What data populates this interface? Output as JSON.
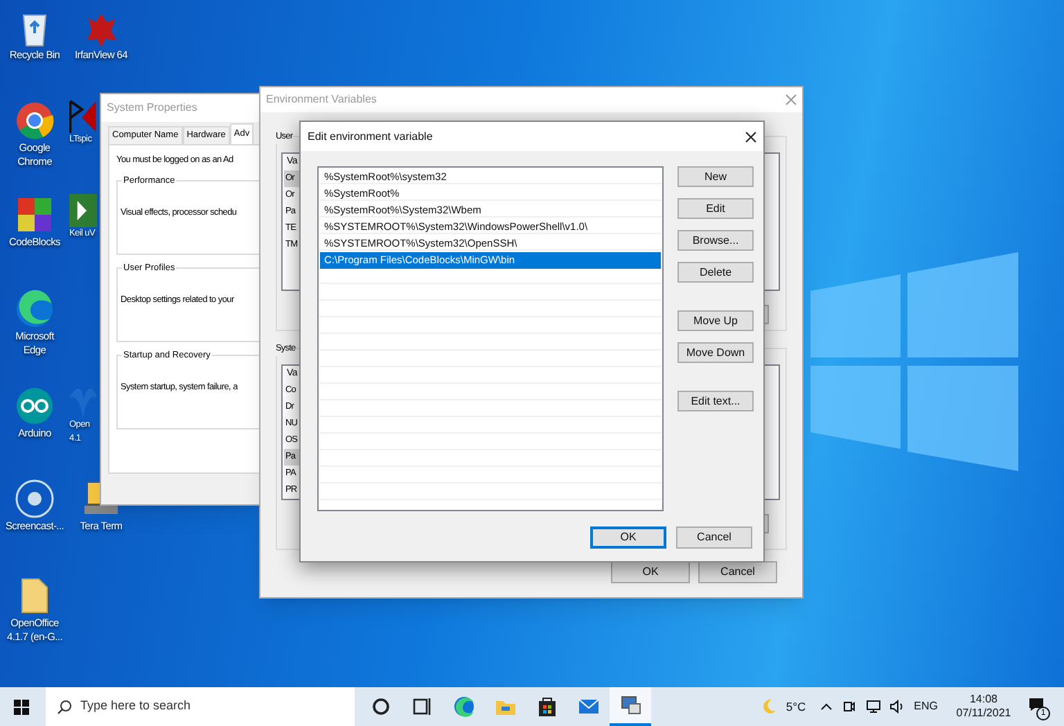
{
  "desktop_icons": [
    {
      "kind": "recycle-bin",
      "label": [
        "Recycle Bin"
      ]
    },
    {
      "kind": "irfanview",
      "label": [
        "IrfanView 64"
      ]
    },
    {
      "kind": "chrome",
      "label": [
        "Google",
        "Chrome"
      ]
    },
    {
      "kind": "ltspice",
      "label": [
        "LTspic"
      ]
    },
    {
      "kind": "codeblocks",
      "label": [
        "CodeBlocks"
      ]
    },
    {
      "kind": "keil",
      "label": [
        "Keil uV"
      ]
    },
    {
      "kind": "edge",
      "label": [
        "Microsoft",
        "Edge"
      ]
    },
    {
      "kind": "arduino",
      "label": [
        "Arduino"
      ]
    },
    {
      "kind": "openoffice",
      "label": [
        "Open",
        "4.1"
      ]
    },
    {
      "kind": "screencast",
      "label": [
        "Screencast-..."
      ]
    },
    {
      "kind": "teraterm",
      "label": [
        "Tera Term"
      ]
    },
    {
      "kind": "folder",
      "label": [
        "OpenOffice",
        "4.1.7 (en-G..."
      ]
    }
  ],
  "system_properties": {
    "title": "System Properties",
    "tabs": [
      {
        "label": "Computer Name",
        "selected": false
      },
      {
        "label": "Hardware",
        "selected": false
      },
      {
        "label": "Adv",
        "selected": true
      }
    ],
    "notice": "You must be logged on as an Ad",
    "groups": [
      {
        "title": "Performance",
        "text": "Visual effects, processor schedu"
      },
      {
        "title": "User Profiles",
        "text": "Desktop settings related to your"
      },
      {
        "title": "Startup and Recovery",
        "text": "System startup, system failure, a"
      }
    ]
  },
  "environment_variables": {
    "title": "Environment Variables",
    "user_group": {
      "label": "User",
      "header": "Va",
      "rows": [
        {
          "text": "Or",
          "selected": true
        },
        {
          "text": "Or",
          "selected": false
        },
        {
          "text": "Pa",
          "selected": false
        },
        {
          "text": "TE",
          "selected": false
        },
        {
          "text": "TM",
          "selected": false
        }
      ]
    },
    "system_group": {
      "label": "Syste",
      "header": "Va",
      "rows": [
        {
          "text": "Co",
          "selected": false
        },
        {
          "text": "Dr",
          "selected": false
        },
        {
          "text": "NU",
          "selected": false
        },
        {
          "text": "OS",
          "selected": false
        },
        {
          "text": "Pa",
          "selected": true
        },
        {
          "text": "PA",
          "selected": false
        },
        {
          "text": "PR",
          "selected": false
        }
      ]
    },
    "buttons": [
      {
        "label": "OK"
      },
      {
        "label": "Cancel"
      }
    ]
  },
  "edit_dialog": {
    "title": "Edit environment variable",
    "entries": [
      {
        "text": "%SystemRoot%\\system32",
        "selected": false
      },
      {
        "text": "%SystemRoot%",
        "selected": false
      },
      {
        "text": "%SystemRoot%\\System32\\Wbem",
        "selected": false
      },
      {
        "text": "%SYSTEMROOT%\\System32\\WindowsPowerShell\\v1.0\\",
        "selected": false
      },
      {
        "text": "%SYSTEMROOT%\\System32\\OpenSSH\\",
        "selected": false
      },
      {
        "text": "C:\\Program Files\\CodeBlocks\\MinGW\\bin",
        "selected": true
      }
    ],
    "side_button_groups": [
      [
        "New",
        "Edit",
        "Browse...",
        "Delete"
      ],
      [
        "Move Up",
        "Move Down"
      ],
      [
        "Edit text..."
      ]
    ],
    "buttons": [
      {
        "label": "OK",
        "default": true
      },
      {
        "label": "Cancel",
        "default": false
      }
    ]
  },
  "taskbar": {
    "search": {
      "placeholder": "Type here to search"
    },
    "apps": [
      {
        "kind": "cortana",
        "active": false
      },
      {
        "kind": "task-view",
        "active": false
      },
      {
        "kind": "edge",
        "active": false
      },
      {
        "kind": "file-explorer",
        "active": false
      },
      {
        "kind": "store",
        "active": false
      },
      {
        "kind": "mail",
        "active": false
      },
      {
        "kind": "system-settings",
        "active": true
      }
    ],
    "temperature": "5°C",
    "language": "ENG",
    "time": "14:08",
    "date": "07/11/2021",
    "notification_count": "1"
  }
}
